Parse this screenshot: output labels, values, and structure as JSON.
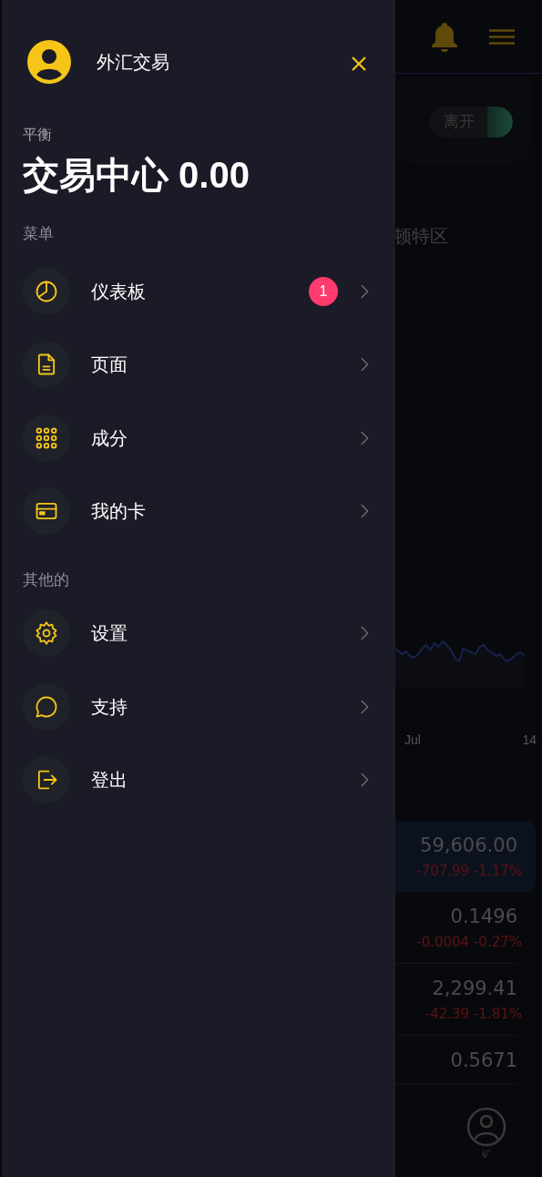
{
  "drawer": {
    "title": "外汇交易",
    "balance_label": "平衡",
    "balance": "交易中心 0.00",
    "sections": [
      {
        "heading": "菜单",
        "items": [
          {
            "label": "仪表板",
            "badge": "1"
          },
          {
            "label": "页面"
          },
          {
            "label": "成分"
          },
          {
            "label": "我的卡"
          }
        ]
      },
      {
        "heading": "其他的",
        "items": [
          {
            "label": "设置"
          },
          {
            "label": "支持"
          },
          {
            "label": "登出"
          }
        ]
      }
    ]
  },
  "background": {
    "toggle": {
      "label": "离开",
      "on": true
    },
    "location": "顿特区",
    "chart_labels": [
      "Jul",
      "14"
    ],
    "rows": [
      {
        "price": "59,606.00",
        "change": "-707.99",
        "percent": "-1.17%",
        "selected": true
      },
      {
        "price": "0.1496",
        "change": "-0.0004",
        "percent": "-0.27%",
        "selected": false
      },
      {
        "price": "2,299.41",
        "change": "-42.39",
        "percent": "-1.81%",
        "selected": false
      },
      {
        "price": "0.5671",
        "selected": false
      }
    ],
    "nav_label": "矿"
  }
}
